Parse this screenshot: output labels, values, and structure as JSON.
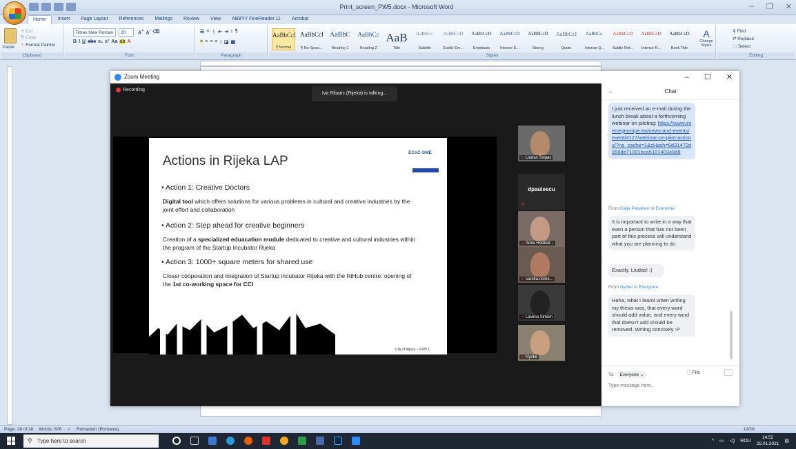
{
  "window": {
    "title": "Print_screen_PW5.docx - Microsoft Word"
  },
  "ribbon": {
    "tabs": [
      "Home",
      "Insert",
      "Page Layout",
      "References",
      "Mailings",
      "Review",
      "View",
      "ABBYY FineReader 11",
      "Acrobat"
    ],
    "clipboard": {
      "paste": "Paste",
      "cut": "Cut",
      "copy": "Copy",
      "format_painter": "Format Painter",
      "label": "Clipboard"
    },
    "font": {
      "name": "Times New Roman",
      "size": "20",
      "label": "Font"
    },
    "paragraph_label": "Paragraph",
    "styles": [
      {
        "sample": "AaBbCcI",
        "name": "¶ Normal"
      },
      {
        "sample": "AaBbCcI",
        "name": "¶ No Spaci..."
      },
      {
        "sample": "AaBbC",
        "name": "Heading 1"
      },
      {
        "sample": "AaBbCc",
        "name": "Heading 2"
      },
      {
        "sample": "AaB",
        "name": "Title"
      },
      {
        "sample": "AaBbCc.",
        "name": "Subtitle"
      },
      {
        "sample": "AaBbCcD",
        "name": "Subtle Em..."
      },
      {
        "sample": "AaBbCcD",
        "name": "Emphasis"
      },
      {
        "sample": "AaBbCcD",
        "name": "Intense E..."
      },
      {
        "sample": "AaBbCcD",
        "name": "Strong"
      },
      {
        "sample": "AaBbCcI",
        "name": "Quote"
      },
      {
        "sample": "AaBbCc.",
        "name": "Intense Q..."
      },
      {
        "sample": "AaBbCcD",
        "name": "Subtle Ref..."
      },
      {
        "sample": "AaBbCcD",
        "name": "Intense R..."
      },
      {
        "sample": "AaBbCcD",
        "name": "Book Title"
      }
    ],
    "styles_label": "Styles",
    "change_styles": "Change Styles",
    "editing": {
      "find": "Find",
      "replace": "Replace",
      "select": "Select",
      "label": "Editing"
    }
  },
  "zoom": {
    "title": "Zoom Meeting",
    "recording": "Recording",
    "talking": "Iva Ribaric (Rijeka) is talking...",
    "slide": {
      "title": "Actions in Rijeka LAP",
      "logo": "ECoC-SME",
      "action1": "• Action 1: Creative Doctors",
      "action1_bold": "Digital tool",
      "action1_text": " which offers solutions for various problems in cultural and creative industries by the joint effort and collaboration",
      "action2": "• Action 2: Step ahead for creative beginners",
      "action2_pre": "Creation of a ",
      "action2_bold": "specialized eduacation module",
      "action2_post": " dedicated to creative and cultural industries within the program of the Startup Incubator Rijeka",
      "action3": "• Action 3: 1000+ square meters for shared use",
      "action3_pre": "Closer cooperation and integration of Startup incubator Rijeka with the RiHub centre: opening of the ",
      "action3_bold": "1st co-working space for CCI",
      "footer": "City of Rijeka – PW5 1"
    },
    "participants": [
      "Liudas Švipas",
      "dpaulescu",
      "Anke Hoekstr...",
      "sarolta.neme...",
      "Lavinia Simion",
      "Nynke"
    ],
    "chat": {
      "title": "Chat",
      "msg1": "I just received an e-mail during the lunch break about a forthcoming webinar on piloting:",
      "msg1_link": "https://www.interregeurope.eu/news-and-events/event/4127/webinar-on-pilot-actions/?no_cache=1&cHash=8d31472d956de71001bca5101403e8d8",
      "from2_name": "Katja Pasanen",
      "from2_to": "Everyone",
      "msg2": "It is important to write in a way that even a person that has not been part of this process will understand what you are planning to do",
      "msg3": "Exactly, Liudas! :)",
      "from3_name": "Nynke",
      "from3_to": "Everyone",
      "msg4": "Haha, what I learnt when writing my thesis was, that every word should add value, and every word that doesn't add should be removed. Writing concisely :P",
      "from_word": "From",
      "to_word": "to",
      "to_label": "To:",
      "to_value": "Everyone ⌄",
      "file": "File",
      "placeholder": "Type message here..."
    }
  },
  "status": {
    "page": "Page: 28 of 28",
    "words": "Words: 676",
    "language": "Romanian (Romania)",
    "zoom": "120%"
  },
  "taskbar": {
    "search": "Type here to search",
    "lang": "ROU",
    "time": "14:52",
    "date": "28.01.2021"
  }
}
